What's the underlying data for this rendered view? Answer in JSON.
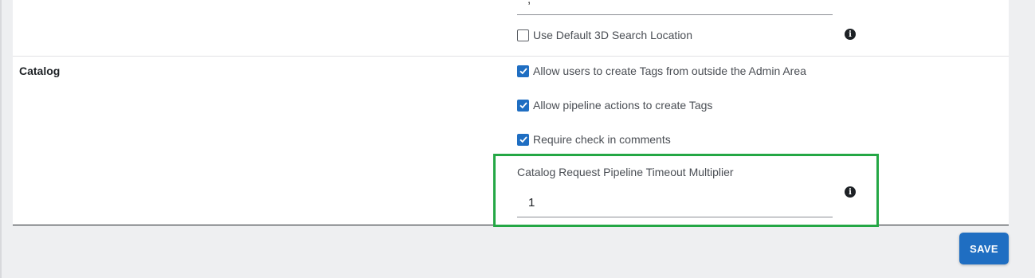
{
  "prev_section": {
    "partial_input_value": ",",
    "checkbox_label": "Use Default 3D Search Location",
    "checkbox_checked": false
  },
  "catalog": {
    "section_label": "Catalog",
    "options": [
      {
        "label": "Allow users to create Tags from outside the Admin Area",
        "checked": true
      },
      {
        "label": "Allow pipeline actions to create Tags",
        "checked": true
      },
      {
        "label": "Require check in comments",
        "checked": true
      }
    ],
    "timeout_field": {
      "label": "Catalog Request Pipeline Timeout Multiplier",
      "value": "1"
    }
  },
  "info_icon_glyph": "i",
  "save_label": "SAVE",
  "colors": {
    "accent": "#1f6ec2",
    "highlight": "#24a745",
    "background": "#eeeff1"
  }
}
